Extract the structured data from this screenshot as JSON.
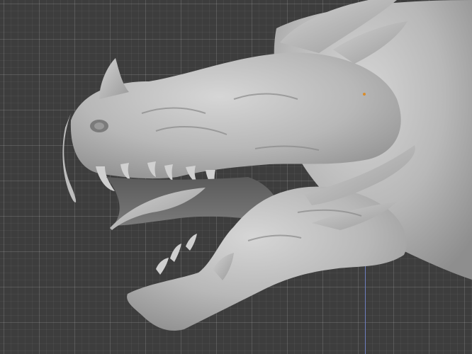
{
  "viewport": {
    "background_color": "#3d3d3d",
    "grid_color": "#4a4a4a",
    "z_axis_color": "#6e7fbf",
    "origin_color": "#d98c2b",
    "mesh_color": "#c4c4c4",
    "mesh_shadow_color": "#7f7f7f",
    "model_icon": "dragon-head-sculpt-icon"
  }
}
